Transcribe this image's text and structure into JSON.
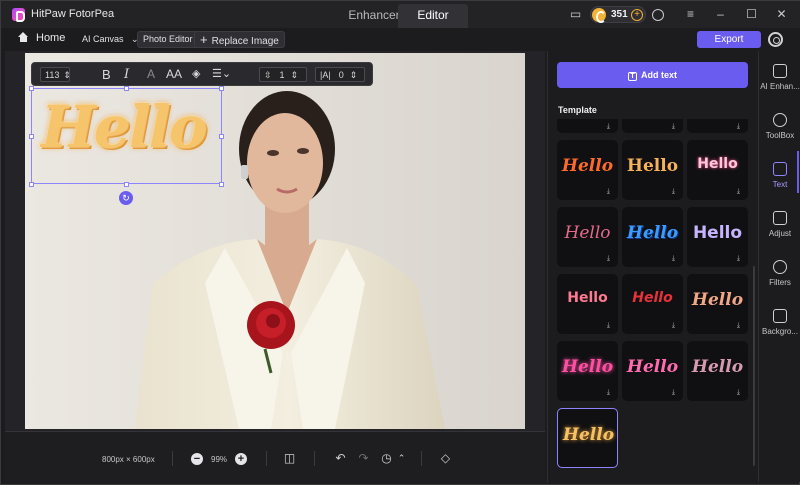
{
  "app": {
    "name": "HitPaw FotorPea",
    "modes": [
      "Enhancer",
      "Editor"
    ],
    "active_mode": "Editor",
    "credits": "351"
  },
  "toolbar": {
    "home": "Home",
    "ai_canvas": "AI Canvas",
    "photo_editor": "Photo Editor",
    "replace_image": "Replace Image",
    "export": "Export"
  },
  "text_toolbar": {
    "font_size": "113",
    "bold": "B",
    "italic": "I",
    "case": "AA",
    "line_spacing": "1",
    "letter_spacing": "0"
  },
  "canvas": {
    "overlay_text": "Hello",
    "dimensions": "800px × 600px",
    "zoom": "99%"
  },
  "panel": {
    "add_text": "Add text",
    "template_title": "Template",
    "templates": [
      {
        "word": "Hello",
        "color": "#ff6a2b"
      },
      {
        "word": "Hello",
        "color": "#f7b35a"
      },
      {
        "word": "Hello",
        "color": "#ffc8dc"
      },
      {
        "word": "Hello",
        "color": "#e56a8a"
      },
      {
        "word": "Hello",
        "color": "#3d9bff"
      },
      {
        "word": "Hello",
        "color": "#c6b4ff"
      },
      {
        "word": "Hello",
        "color": "#ff7a90"
      },
      {
        "word": "Hello",
        "color": "#e8323a"
      },
      {
        "word": "Hello",
        "color": "#f2a887"
      },
      {
        "word": "Hello",
        "color": "#ff4fa3"
      },
      {
        "word": "Hello",
        "color": "#ff6cb0"
      },
      {
        "word": "Hello",
        "color": "#d79ab0"
      },
      {
        "word": "Hello",
        "color": "#f7c266"
      }
    ],
    "download_icon": "download-icon"
  },
  "rail": [
    {
      "label": "AI Enhan...",
      "icon": "ai-enhance-icon"
    },
    {
      "label": "ToolBox",
      "icon": "toolbox-icon"
    },
    {
      "label": "Text",
      "icon": "text-icon"
    },
    {
      "label": "Adjust",
      "icon": "adjust-icon"
    },
    {
      "label": "Filters",
      "icon": "filters-icon"
    },
    {
      "label": "Backgro...",
      "icon": "background-icon"
    }
  ],
  "colors": {
    "accent": "#6b5cf0",
    "selection": "#8f84ff",
    "background": "#1c1c1f"
  }
}
